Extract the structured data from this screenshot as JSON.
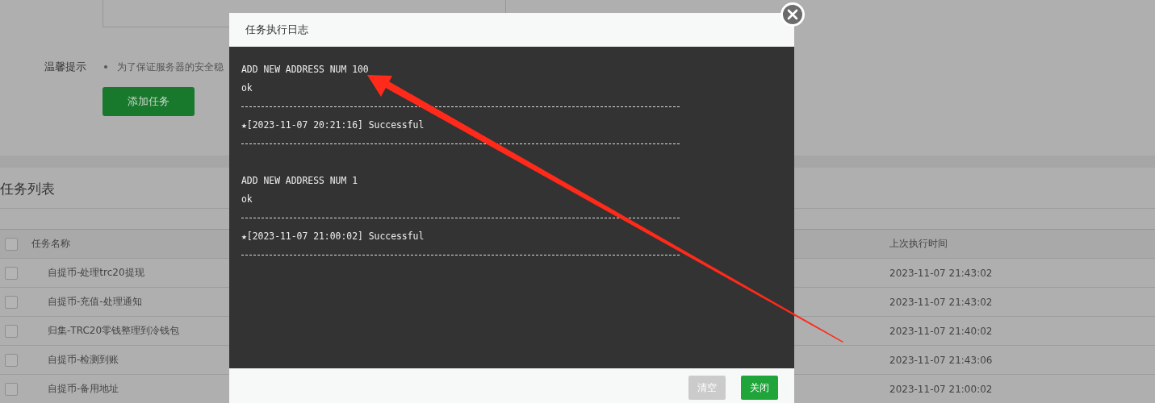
{
  "tip": {
    "label": "温馨提示",
    "text": "为了保证服务器的安全稳"
  },
  "add_button": "添加任务",
  "task_list": {
    "title": "任务列表",
    "all_checked": false,
    "columns": [
      "任务名称",
      "上次执行时间"
    ],
    "rows": [
      {
        "name": "自提币-处理trc20提现",
        "last_run": "2023-11-07 21:43:02",
        "checked": false
      },
      {
        "name": "自提币-充值-处理通知",
        "last_run": "2023-11-07 21:43:02",
        "checked": false
      },
      {
        "name": "归集-TRC20零钱整理到冷钱包",
        "last_run": "2023-11-07 21:40:02",
        "checked": false
      },
      {
        "name": "自提币-检测到账",
        "last_run": "2023-11-07 21:43:06",
        "checked": false
      },
      {
        "name": "自提币-备用地址",
        "last_run": "2023-11-07 21:00:02",
        "checked": false
      }
    ]
  },
  "dialog": {
    "title": "任务执行日志",
    "log_blocks": [
      {
        "lines": [
          {
            "kind": "text",
            "text": "ADD NEW ADDRESS NUM 100"
          },
          {
            "kind": "text",
            "text": "ok"
          },
          {
            "kind": "divider"
          },
          {
            "kind": "text",
            "text": "★[2023-11-07 20:21:16] Successful"
          },
          {
            "kind": "divider"
          }
        ]
      },
      {
        "lines": [
          {
            "kind": "text",
            "text": "ADD NEW ADDRESS NUM 1"
          },
          {
            "kind": "text",
            "text": "ok"
          },
          {
            "kind": "divider"
          },
          {
            "kind": "text",
            "text": "★[2023-11-07 21:00:02] Successful"
          },
          {
            "kind": "divider"
          }
        ]
      }
    ],
    "buttons": [
      {
        "label": "清空",
        "kind": "secondary"
      },
      {
        "label": "关闭",
        "kind": "primary"
      }
    ]
  }
}
